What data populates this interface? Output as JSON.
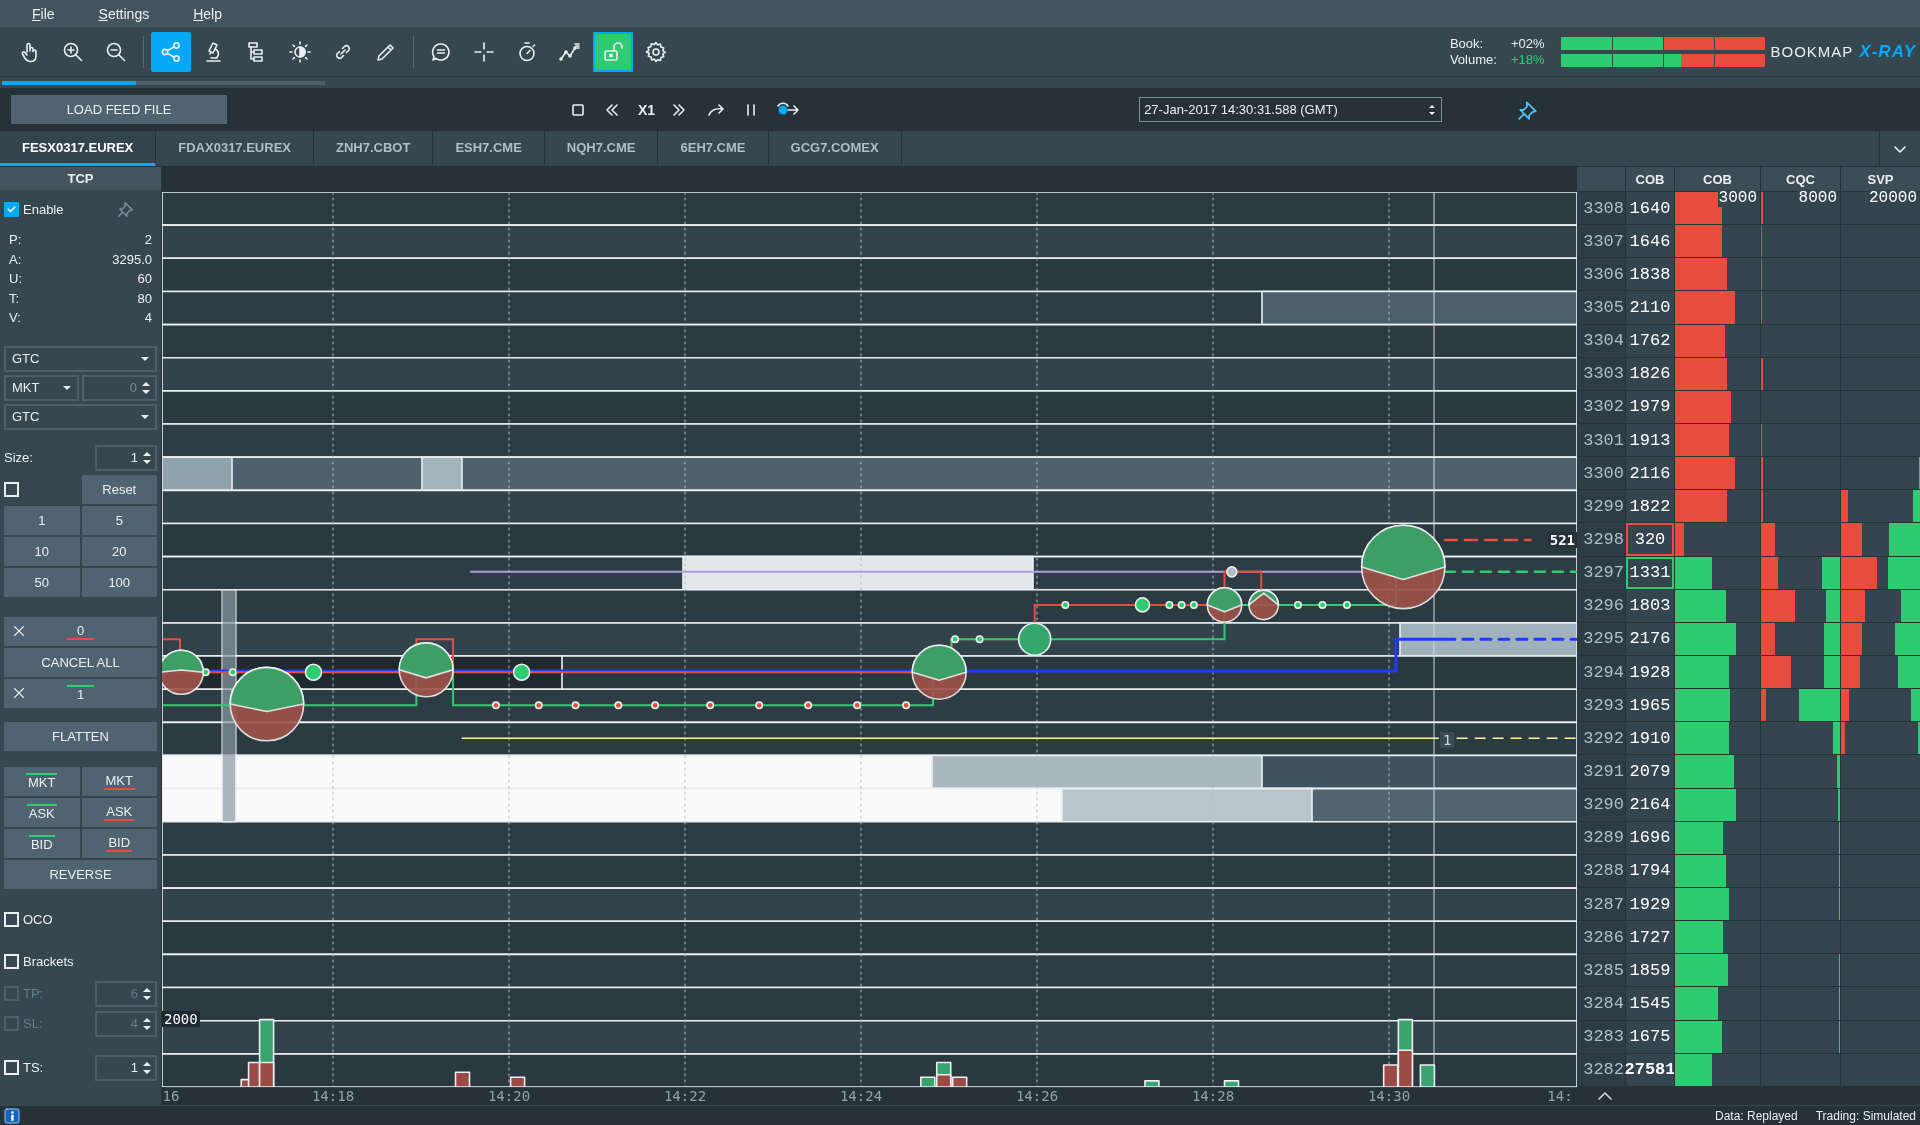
{
  "menu": [
    {
      "label": "File"
    },
    {
      "label": "Settings"
    },
    {
      "label": "Help"
    }
  ],
  "toolbar": {
    "tools": [
      {
        "selected": false,
        "on": false
      },
      {
        "selected": false,
        "on": false
      },
      {
        "selected": false,
        "on": false
      },
      {
        "selected": true,
        "on": false
      },
      {
        "selected": false,
        "on": false
      },
      {
        "selected": false,
        "on": false
      },
      {
        "selected": false,
        "on": false
      },
      {
        "selected": false,
        "on": false
      },
      {
        "selected": false,
        "on": false
      },
      {
        "selected": false,
        "on": false
      },
      {
        "selected": false,
        "on": false
      },
      {
        "selected": false,
        "on": false
      },
      {
        "selected": false,
        "on": false
      },
      {
        "selected": false,
        "on": true
      },
      {
        "selected": false,
        "on": false
      }
    ],
    "imbalance": [
      {
        "label": "Book:",
        "value": "+02%",
        "color": "#eceff1",
        "level": 0.5
      },
      {
        "label": "Volume:",
        "value": "+18%",
        "color": "#2ecc71",
        "level": 0.59
      }
    ],
    "logo": {
      "name": "BOOKMAP",
      "product": "X-RAY"
    }
  },
  "replay": {
    "progress": {
      "level": 0.41
    },
    "load_button": "LOAD FEED FILE",
    "speed": "X1",
    "datetime": "27-Jan-2017 14:30:31.588 (GMT)"
  },
  "tabs": [
    {
      "label": "FESX0317.EUREX",
      "selected": true
    },
    {
      "label": "FDAX0317.EUREX",
      "selected": false
    },
    {
      "label": "ZNH7.CBOT",
      "selected": false
    },
    {
      "label": "ESH7.CME",
      "selected": false
    },
    {
      "label": "NQH7.CME",
      "selected": false
    },
    {
      "label": "6EH7.CME",
      "selected": false
    },
    {
      "label": "GCG7.COMEX",
      "selected": false
    }
  ],
  "tcp": {
    "title": "TCP",
    "enable": {
      "label": "Enable",
      "checked": true
    },
    "stats": [
      {
        "label": "P:",
        "value": "2"
      },
      {
        "label": "A:",
        "value": "3295.0"
      },
      {
        "label": "U:",
        "value": "60"
      },
      {
        "label": "T:",
        "value": "80"
      },
      {
        "label": "V:",
        "value": "4"
      }
    ],
    "tif": "GTC",
    "order_type": "MKT",
    "price": "0",
    "tif2": "GTC",
    "size": {
      "label": "Size:",
      "value": "1"
    },
    "size_lock": {
      "checked": false
    },
    "reset": "Reset",
    "size_buttons": [
      "1",
      "5",
      "10",
      "20",
      "50",
      "100"
    ],
    "sell_orders": "0",
    "cancel_all": "CANCEL ALL",
    "buy_orders": "1",
    "flatten": "FLATTEN",
    "trade_buttons": [
      {
        "label": "MKT",
        "kind": "buy"
      },
      {
        "label": "MKT",
        "kind": "sell"
      },
      {
        "label": "ASK",
        "kind": "buy"
      },
      {
        "label": "ASK",
        "kind": "sell"
      },
      {
        "label": "BID",
        "kind": "buy"
      },
      {
        "label": "BID",
        "kind": "sell"
      }
    ],
    "reverse": "REVERSE",
    "options": [
      {
        "kind": "checkbox",
        "label": "OCO",
        "checked": false,
        "disabled": false
      },
      {
        "kind": "checkbox",
        "label": "Brackets",
        "checked": false,
        "disabled": false
      },
      {
        "kind": "spinner",
        "label": "TP:",
        "checked": false,
        "disabled": true,
        "value": "6"
      },
      {
        "kind": "spinner",
        "label": "SL:",
        "checked": false,
        "disabled": true,
        "value": "4"
      },
      {
        "kind": "spinner",
        "label": "TS:",
        "checked": false,
        "disabled": false,
        "value": "1"
      }
    ]
  },
  "chart": {
    "time_labels": [
      "16",
      "14:18",
      "14:20",
      "14:22",
      "14:24",
      "14:26",
      "14:28",
      "14:30",
      "14:"
    ],
    "ask_order_label": "521",
    "position_label": "1",
    "volume_scale": "2000"
  },
  "ladder": {
    "headers": [
      "COB",
      "COB",
      "CQC",
      "SVP"
    ],
    "scales": [
      "3000",
      "8000",
      "20000"
    ],
    "rows": [
      {
        "kind": "level",
        "price": "3308",
        "cob": "1640",
        "color": "#e74c3c",
        "best": false,
        "bar": {
          "level": 0.55
        },
        "cqc_sell": {
          "level": 0.02
        }
      },
      {
        "kind": "level",
        "price": "3307",
        "cob": "1646",
        "color": "#e74c3c",
        "best": false,
        "bar": {
          "level": 0.55
        },
        "cqc_sell": {
          "level": 0.015
        }
      },
      {
        "kind": "level",
        "price": "3306",
        "cob": "1838",
        "color": "#e74c3c",
        "best": false,
        "bar": {
          "level": 0.61
        },
        "cqc_sell": {
          "level": 0.015
        }
      },
      {
        "kind": "level",
        "price": "3305",
        "cob": "2110",
        "color": "#e74c3c",
        "best": false,
        "bar": {
          "level": 0.7
        },
        "cqc_sell": {
          "level": 0.015
        }
      },
      {
        "kind": "level",
        "price": "3304",
        "cob": "1762",
        "color": "#e74c3c",
        "best": false,
        "bar": {
          "level": 0.59
        }
      },
      {
        "kind": "level",
        "price": "3303",
        "cob": "1826",
        "color": "#e74c3c",
        "best": false,
        "bar": {
          "level": 0.61
        },
        "cqc_sell": {
          "level": 0.025
        }
      },
      {
        "kind": "level",
        "price": "3302",
        "cob": "1979",
        "color": "#e74c3c",
        "best": false,
        "bar": {
          "level": 0.66
        }
      },
      {
        "kind": "level",
        "price": "3301",
        "cob": "1913",
        "color": "#e74c3c",
        "best": false,
        "bar": {
          "level": 0.64
        },
        "cqc_sell": {
          "level": 0.01
        }
      },
      {
        "kind": "level",
        "price": "3300",
        "cob": "2116",
        "color": "#e74c3c",
        "best": false,
        "bar": {
          "level": 0.7
        },
        "cqc_sell": {
          "level": 0.02
        },
        "svp_buy": {
          "level": 0.015
        }
      },
      {
        "kind": "level",
        "price": "3299",
        "cob": "1822",
        "color": "#e74c3c",
        "best": false,
        "bar": {
          "level": 0.61
        },
        "cqc_sell": {
          "level": 0.03
        },
        "svp_sell": {
          "level": 0.09
        },
        "svp_buy": {
          "level": 0.09
        }
      },
      {
        "kind": "level",
        "price": "3298",
        "cob": "320",
        "color": "#e74c3c",
        "best": true,
        "bar": {
          "level": 0.1
        },
        "cqc_sell": {
          "level": 0.18
        },
        "svp_sell": {
          "level": 0.26
        },
        "svp_buy": {
          "level": 0.39
        }
      },
      {
        "kind": "level",
        "price": "3297",
        "cob": "1331",
        "color": "#2ecc71",
        "best": true,
        "bar": {
          "level": 0.44
        },
        "cqc_sell": {
          "level": 0.22
        },
        "cqc_buy": {
          "level": 0.23
        },
        "svp_sell": {
          "level": 0.45
        },
        "svp_buy": {
          "level": 0.4
        }
      },
      {
        "kind": "level",
        "price": "3296",
        "cob": "1803",
        "color": "#2ecc71",
        "best": false,
        "bar": {
          "level": 0.6
        },
        "cqc_sell": {
          "level": 0.43
        },
        "cqc_buy": {
          "level": 0.18
        },
        "svp_sell": {
          "level": 0.3
        },
        "svp_buy": {
          "level": 0.24
        }
      },
      {
        "kind": "level",
        "price": "3295",
        "cob": "2176",
        "color": "#2ecc71",
        "best": false,
        "bar": {
          "level": 0.72
        },
        "cqc_sell": {
          "level": 0.18
        },
        "cqc_buy": {
          "level": 0.2
        },
        "svp_sell": {
          "level": 0.26
        },
        "svp_buy": {
          "level": 0.32
        }
      },
      {
        "kind": "level",
        "price": "3294",
        "cob": "1928",
        "color": "#2ecc71",
        "best": false,
        "bar": {
          "level": 0.64
        },
        "cqc_sell": {
          "level": 0.38
        },
        "cqc_buy": {
          "level": 0.2
        },
        "svp_sell": {
          "level": 0.24
        },
        "svp_buy": {
          "level": 0.28
        }
      },
      {
        "kind": "level",
        "price": "3293",
        "cob": "1965",
        "color": "#2ecc71",
        "best": false,
        "bar": {
          "level": 0.65
        },
        "cqc_sell": {
          "level": 0.06
        },
        "cqc_buy": {
          "level": 0.52
        },
        "svp_sell": {
          "level": 0.1
        },
        "svp_buy": {
          "level": 0.12
        }
      },
      {
        "kind": "level",
        "price": "3292",
        "cob": "1910",
        "color": "#2ecc71",
        "best": false,
        "bar": {
          "level": 0.63
        },
        "cqc_buy": {
          "level": 0.09
        },
        "svp_sell": {
          "level": 0.05
        },
        "svp_buy": {
          "level": 0.02
        }
      },
      {
        "kind": "level",
        "price": "3291",
        "cob": "2079",
        "color": "#2ecc71",
        "best": false,
        "bar": {
          "level": 0.69
        },
        "cqc_buy": {
          "level": 0.04
        }
      },
      {
        "kind": "level",
        "price": "3290",
        "cob": "2164",
        "color": "#2ecc71",
        "best": false,
        "bar": {
          "level": 0.72
        },
        "cqc_buy": {
          "level": 0.02
        }
      },
      {
        "kind": "level",
        "price": "3289",
        "cob": "1696",
        "color": "#2ecc71",
        "best": false,
        "bar": {
          "level": 0.56
        },
        "cqc_buy": {
          "level": 0.01
        }
      },
      {
        "kind": "level",
        "price": "3288",
        "cob": "1794",
        "color": "#2ecc71",
        "best": false,
        "bar": {
          "level": 0.6
        },
        "cqc_buy": {
          "level": 0.015
        }
      },
      {
        "kind": "level",
        "price": "3287",
        "cob": "1929",
        "color": "#2ecc71",
        "best": false,
        "bar": {
          "level": 0.64
        },
        "cqc_buy": {
          "level": 0.01
        }
      },
      {
        "kind": "level",
        "price": "3286",
        "cob": "1727",
        "color": "#2ecc71",
        "best": false,
        "bar": {
          "level": 0.57
        }
      },
      {
        "kind": "level",
        "price": "3285",
        "cob": "1859",
        "color": "#2ecc71",
        "best": false,
        "bar": {
          "level": 0.62
        },
        "cqc_buy": {
          "level": 0.01
        }
      },
      {
        "kind": "level",
        "price": "3284",
        "cob": "1545",
        "color": "#2ecc71",
        "best": false,
        "bar": {
          "level": 0.51
        },
        "cqc_buy": {
          "level": 0.01
        }
      },
      {
        "kind": "level",
        "price": "3283",
        "cob": "1675",
        "color": "#2ecc71",
        "best": false,
        "bar": {
          "level": 0.55
        },
        "cqc_buy": {
          "level": 0.01
        }
      },
      {
        "kind": "total",
        "price": "3282",
        "cob": "27581",
        "color": "#2ecc71",
        "best": false,
        "bar": {
          "level": 0.44
        }
      }
    ]
  },
  "status": [
    "Data: Replayed",
    "Trading: Simulated"
  ]
}
